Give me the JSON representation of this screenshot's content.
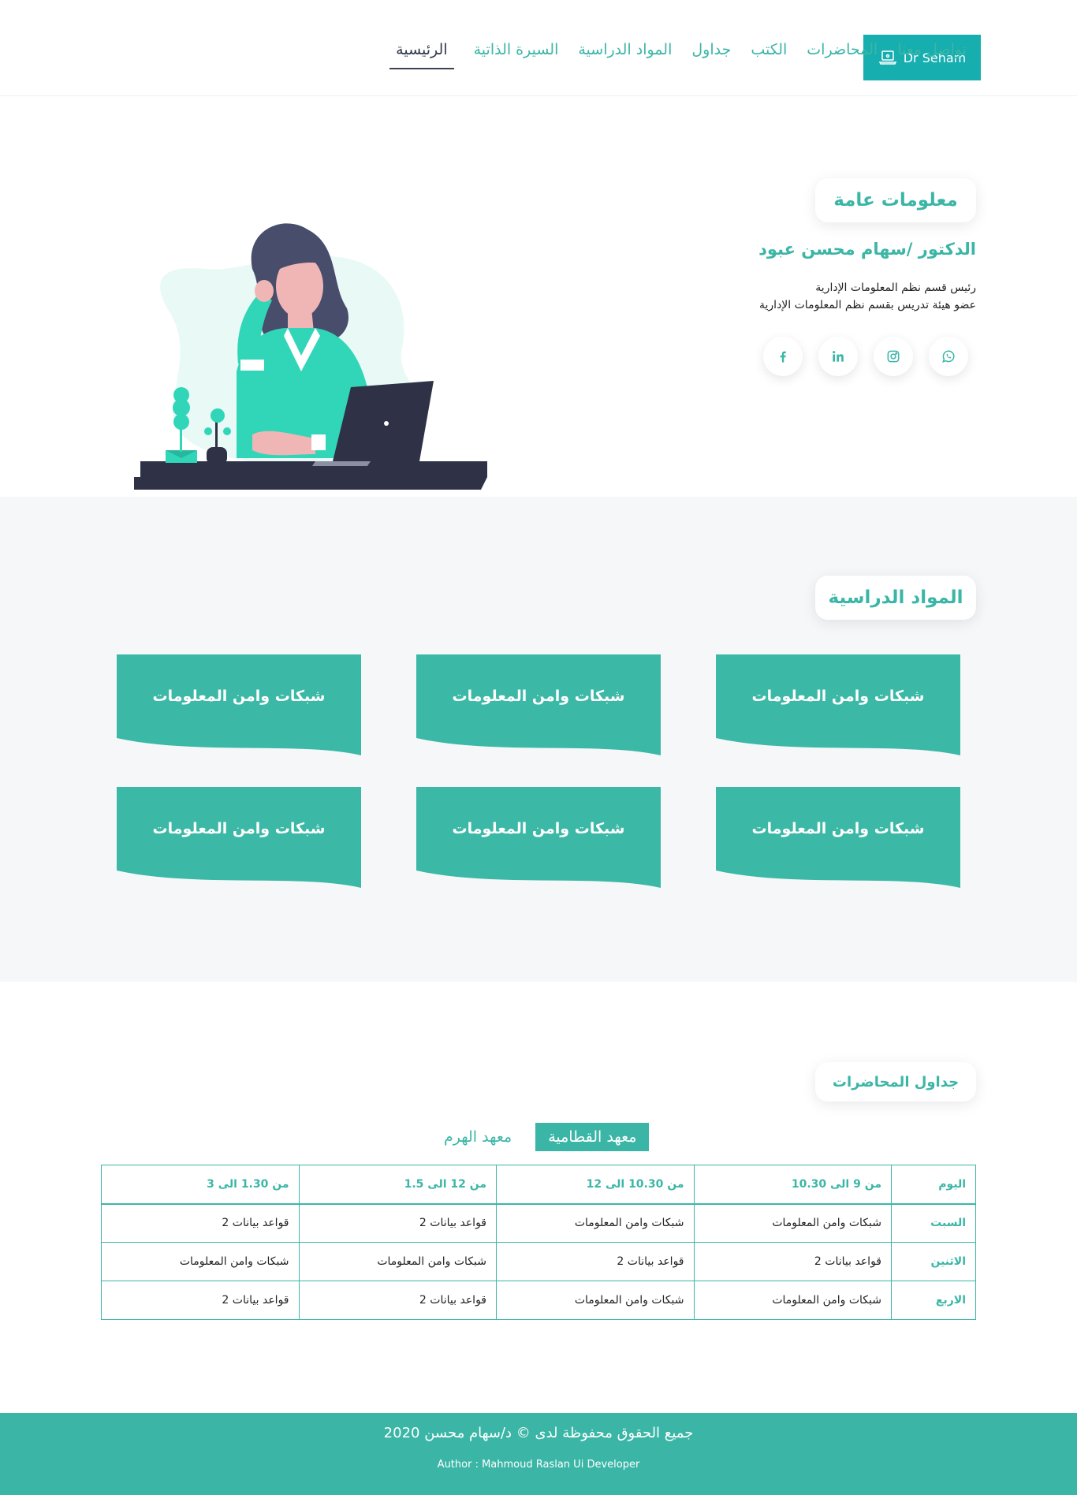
{
  "brand": {
    "label": "Dr Seham",
    "icon": "laptop-icon"
  },
  "nav": {
    "items": [
      {
        "label": "الرئيسية",
        "active": true
      },
      {
        "label": "السيرة الذاتية",
        "active": false
      },
      {
        "label": "المواد الدراسية",
        "active": false
      },
      {
        "label": "جداول",
        "active": false
      },
      {
        "label": "الكتب",
        "active": false
      },
      {
        "label": "المحاضرات",
        "active": false
      },
      {
        "label": "تواصل معنا",
        "active": false
      }
    ]
  },
  "hero": {
    "section_title": "معلومات عامة",
    "name": "الدكتور /سهام محسن عبود",
    "roles": [
      "رئيس قسم نظم المعلومات الإدارية",
      "عضو هيئة تدريس بقسم نظم المعلومات الإدارية"
    ],
    "socials": [
      "whatsapp-icon",
      "instagram-icon",
      "linkedin-icon",
      "facebook-icon"
    ]
  },
  "subjects": {
    "section_title": "المواد الدراسية",
    "cards": [
      "شبكات وامن المعلومات",
      "شبكات وامن المعلومات",
      "شبكات وامن المعلومات",
      "شبكات وامن المعلومات",
      "شبكات وامن المعلومات",
      "شبكات وامن المعلومات"
    ]
  },
  "schedule": {
    "section_title": "جداول المحاضرات",
    "tabs": [
      {
        "label": "معهد القطامية",
        "active": true
      },
      {
        "label": "معهد الهرم",
        "active": false
      }
    ],
    "headers": [
      "اليوم",
      "من 9 الى 10.30",
      "من 10.30 الى 12",
      "من 12 الى 1.5",
      "من 1.30 الى 3"
    ],
    "rows": [
      [
        "السبت",
        "شبكات وامن المعلومات",
        "شبكات وامن المعلومات",
        "قواعد بيانات 2",
        "قواعد بيانات 2"
      ],
      [
        "الاثنين",
        "قواعد بيانات 2",
        "قواعد بيانات 2",
        "شبكات وامن المعلومات",
        "شبكات وامن المعلومات"
      ],
      [
        "الاربع",
        "شبكات وامن المعلومات",
        "شبكات وامن المعلومات",
        "قواعد بيانات 2",
        "قواعد بيانات 2"
      ]
    ]
  },
  "footer": {
    "copyright": "جميع الحقوق محفوظة لدى © د/سهام محسن 2020",
    "author": "Author : Mahmoud Raslan Ui Developer"
  },
  "colors": {
    "accent": "#3bb6a6",
    "brand": "#17aeb0",
    "section_bg": "#f5f7f9"
  }
}
